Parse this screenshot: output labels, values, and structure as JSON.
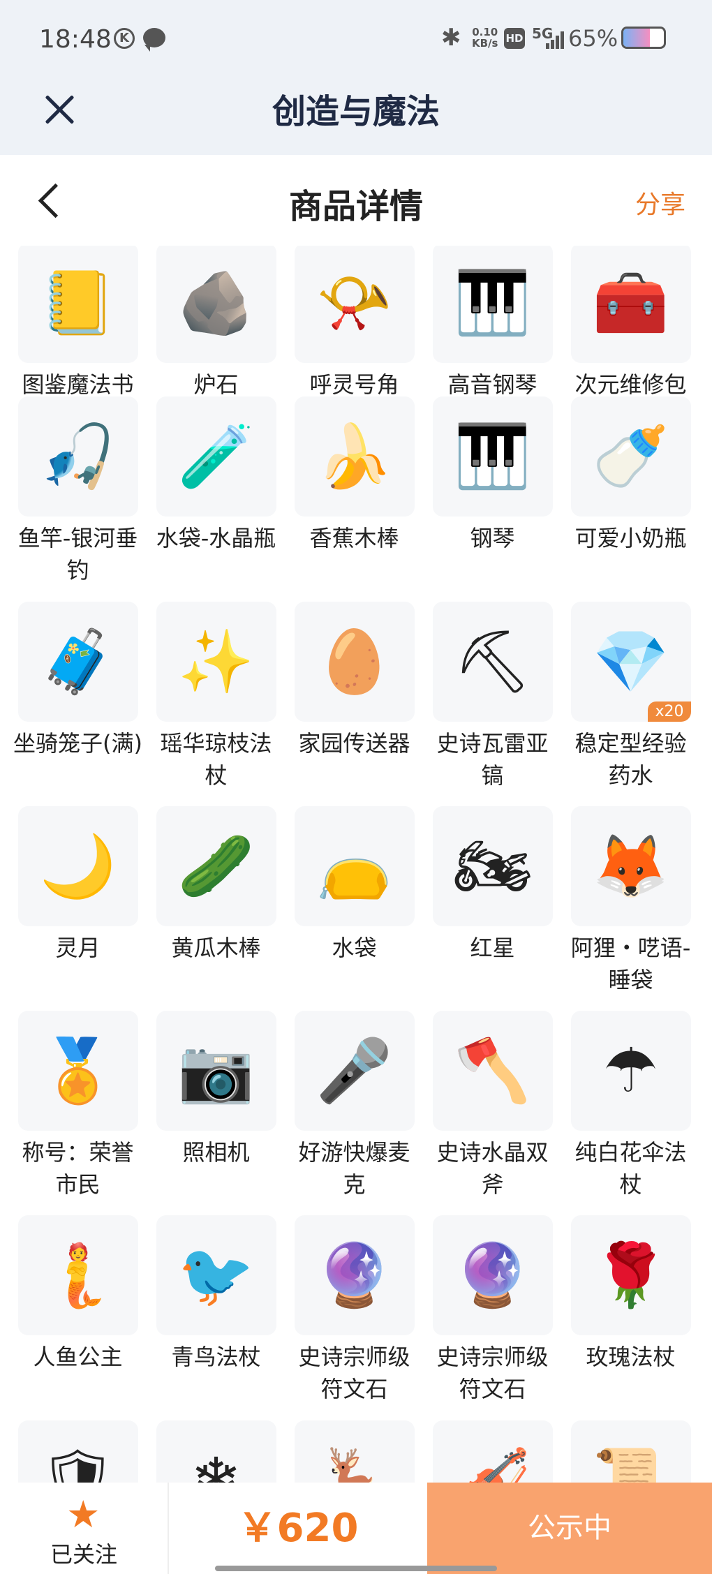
{
  "status_bar": {
    "time": "18:48",
    "k_icon": "K",
    "net_speed": "0.10\nKB/s",
    "net_speed_top": "0.10",
    "net_speed_bottom": "KB/s",
    "hd": "HD",
    "network": "5G",
    "battery_pct": "65%",
    "battery_level": 0.65
  },
  "app_bar": {
    "title": "创造与魔法"
  },
  "nav_bar": {
    "title": "商品详情",
    "share_label": "分享"
  },
  "items": [
    {
      "name": "图鉴魔法书",
      "icon": "📒"
    },
    {
      "name": "炉石",
      "icon": "🪨"
    },
    {
      "name": "呼灵号角",
      "icon": "📯"
    },
    {
      "name": "高音钢琴",
      "icon": "🎹"
    },
    {
      "name": "次元维修包",
      "icon": "🧰"
    },
    {
      "name": "鱼竿-银河垂钓",
      "icon": "🎣"
    },
    {
      "name": "水袋-水晶瓶",
      "icon": "🧪"
    },
    {
      "name": "香蕉木棒",
      "icon": "🍌"
    },
    {
      "name": "钢琴",
      "icon": "🎹"
    },
    {
      "name": "可爱小奶瓶",
      "icon": "🍼"
    },
    {
      "name": "坐骑笼子(满)",
      "icon": "🧳"
    },
    {
      "name": "瑶华琼枝法杖",
      "icon": "✨"
    },
    {
      "name": "家园传送器",
      "icon": "🥚"
    },
    {
      "name": "史诗瓦雷亚镐",
      "icon": "⛏"
    },
    {
      "name": "稳定型经验药水",
      "icon": "💎",
      "badge": "x20"
    },
    {
      "name": "灵月",
      "icon": "🌙"
    },
    {
      "name": "黄瓜木棒",
      "icon": "🥒"
    },
    {
      "name": "水袋",
      "icon": "👝"
    },
    {
      "name": "红星",
      "icon": "🏍"
    },
    {
      "name": "阿狸・呓语-睡袋",
      "icon": "🦊"
    },
    {
      "name": "称号：荣誉市民",
      "icon": "🏅"
    },
    {
      "name": "照相机",
      "icon": "📷"
    },
    {
      "name": "好游快爆麦克",
      "icon": "🎤"
    },
    {
      "name": "史诗水晶双斧",
      "icon": "🪓"
    },
    {
      "name": "纯白花伞法杖",
      "icon": "☂"
    },
    {
      "name": "人鱼公主",
      "icon": "🧜"
    },
    {
      "name": "青鸟法杖",
      "icon": "🐦"
    },
    {
      "name": "史诗宗师级符文石",
      "icon": "🔮"
    },
    {
      "name": "史诗宗师级符文石",
      "icon": "🔮"
    },
    {
      "name": "玫瑰法杖",
      "icon": "🌹"
    },
    {
      "name": "",
      "icon": "🛡"
    },
    {
      "name": "",
      "icon": "❄"
    },
    {
      "name": "",
      "icon": "🦌"
    },
    {
      "name": "",
      "icon": "🎻"
    },
    {
      "name": "",
      "icon": "📜"
    }
  ],
  "bottom_bar": {
    "follow_label": "已关注",
    "star_icon": "★",
    "price": "￥620",
    "status_label": "公示中"
  },
  "colors": {
    "accent": "#f27a24",
    "status_button": "#f9a36e",
    "header_bg": "#eef2f7",
    "title_dark": "#1f2a44"
  }
}
